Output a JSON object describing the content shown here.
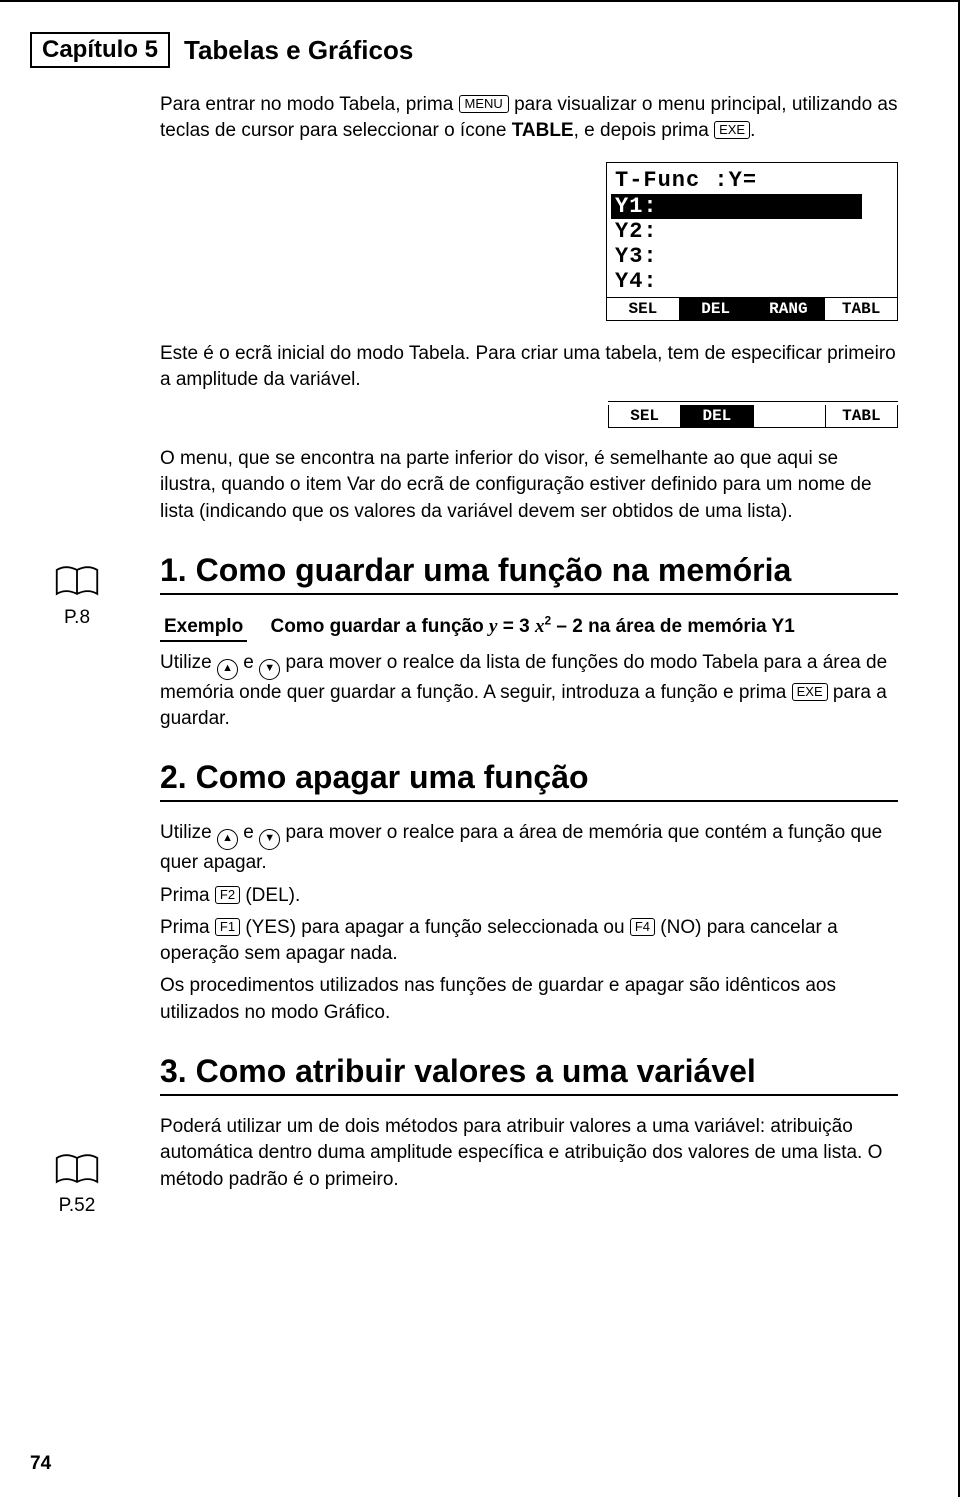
{
  "header": {
    "chapter_label": "Capítulo 5",
    "chapter_title": "Tabelas e Gráficos"
  },
  "keys": {
    "menu": "MENU",
    "exe": "EXE",
    "f1": "F1",
    "f2": "F2",
    "f4": "F4",
    "up": "▲",
    "down": "▼"
  },
  "intro": {
    "p1a": "Para entrar no modo Tabela, prima ",
    "p1b": " para visualizar o menu principal, utilizando as teclas de cursor para seleccionar o ícone ",
    "p1_table": "TABLE",
    "p1c": ", e depois prima ",
    "p1d": "."
  },
  "lcd1": {
    "l1": "T-Func :Y=",
    "l2_hi": "Y1:",
    "l3": "Y2:",
    "l4": "Y3:",
    "l5": "Y4:",
    "foot": [
      "SEL",
      "DEL",
      "RANG",
      "TABL"
    ],
    "foot_inv_index": 1
  },
  "p2": "Este é o ecrã inicial do modo Tabela. Para criar uma tabela, tem de especificar primeiro a amplitude da variável.",
  "lcd2": {
    "foot": [
      "SEL",
      "DEL",
      "",
      "TABL"
    ],
    "foot_inv_index": 1
  },
  "ref1": {
    "label": "P.8"
  },
  "p3": "O menu, que se encontra na parte inferior do visor, é semelhante ao que aqui se ilustra, quando o item Var do ecrã de configuração estiver definido para um nome de lista (indicando que os valores da variável devem ser obtidos de uma lista).",
  "sec1": {
    "title": "1. Como guardar uma função na memória",
    "example_label": "Exemplo",
    "example_a": "Como guardar a função ",
    "example_eq_y": "y",
    "example_eq_mid": " = 3 ",
    "example_eq_x": "x",
    "example_eq_exp": "2",
    "example_b": " – 2 na área de memória Y1",
    "p_a": "Utilize ",
    "p_b": " e ",
    "p_c": " para mover o realce da lista de funções do modo Tabela para a área de memória onde quer guardar a função. A seguir, introduza a função e prima ",
    "p_d": " para a guardar."
  },
  "sec2": {
    "title": "2. Como apagar uma função",
    "p1a": "Utilize ",
    "p1b": " e ",
    "p1c": " para mover o realce para a área de memória que contém a função que quer apagar.",
    "p2a": "Prima ",
    "p2b": " (DEL).",
    "p3a": "Prima ",
    "p3b": " (YES) para apagar a função seleccionada ou ",
    "p3c": " (NO) para cancelar a operação sem apagar nada.",
    "p4": "Os procedimentos utilizados nas funções de guardar e apagar são idênticos aos utilizados no modo Gráfico."
  },
  "ref2": {
    "label": "P.52"
  },
  "sec3": {
    "title": "3. Como atribuir valores a uma variável",
    "p": "Poderá utilizar um de dois métodos para atribuir valores a uma variável: atribuição automática dentro duma amplitude específica e atribuição dos valores de uma lista. O método padrão é o primeiro."
  },
  "page_number": "74"
}
